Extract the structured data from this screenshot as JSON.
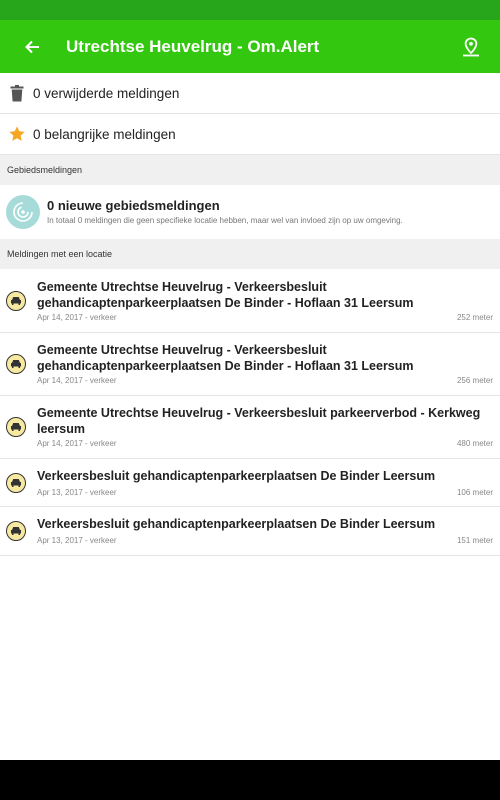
{
  "header": {
    "title": "Utrechtse Heuvelrug - Om.Alert",
    "colors": {
      "appbar": "#33c80f",
      "statusbar": "#28a61b"
    },
    "icons": {
      "back": "arrow-back-icon",
      "map": "map-marker-icon"
    }
  },
  "summary": {
    "deleted": {
      "label": "0 verwijderde meldingen",
      "icon": "trash-icon"
    },
    "important": {
      "label": "0 belangrijke meldingen",
      "icon": "star-icon",
      "icon_color": "#f5a623"
    }
  },
  "area_section": {
    "header": "Gebiedsmeldingen",
    "title": "0 nieuwe gebiedsmeldingen",
    "subtitle": "In totaal 0 meldingen die geen specifieke locatie hebben, maar wel van invloed zijn op uw omgeving.",
    "icon": "radar-icon"
  },
  "location_section": {
    "header": "Meldingen met een locatie",
    "items": [
      {
        "title": "Gemeente Utrechtse Heuvelrug - Verkeersbesluit gehandicaptenparkeerplaatsen De Binder - Hoflaan 31 Leersum",
        "meta": "Apr 14, 2017 - verkeer",
        "distance": "252 meter"
      },
      {
        "title": "Gemeente Utrechtse Heuvelrug - Verkeersbesluit gehandicaptenparkeerplaatsen De Binder - Hoflaan 31 Leersum",
        "meta": "Apr 14, 2017 - verkeer",
        "distance": "256 meter"
      },
      {
        "title": "Gemeente Utrechtse Heuvelrug - Verkeersbesluit parkeerverbod - Kerkweg leersum",
        "meta": "Apr 14, 2017 - verkeer",
        "distance": "480 meter"
      },
      {
        "title": "Verkeersbesluit gehandicaptenparkeerplaatsen De Binder Leersum",
        "meta": "Apr 13, 2017 - verkeer",
        "distance": "106 meter"
      },
      {
        "title": "Verkeersbesluit gehandicaptenparkeerplaatsen De Binder Leersum",
        "meta": "Apr 13, 2017 - verkeer",
        "distance": "151 meter"
      }
    ],
    "item_icon": "car-icon"
  }
}
